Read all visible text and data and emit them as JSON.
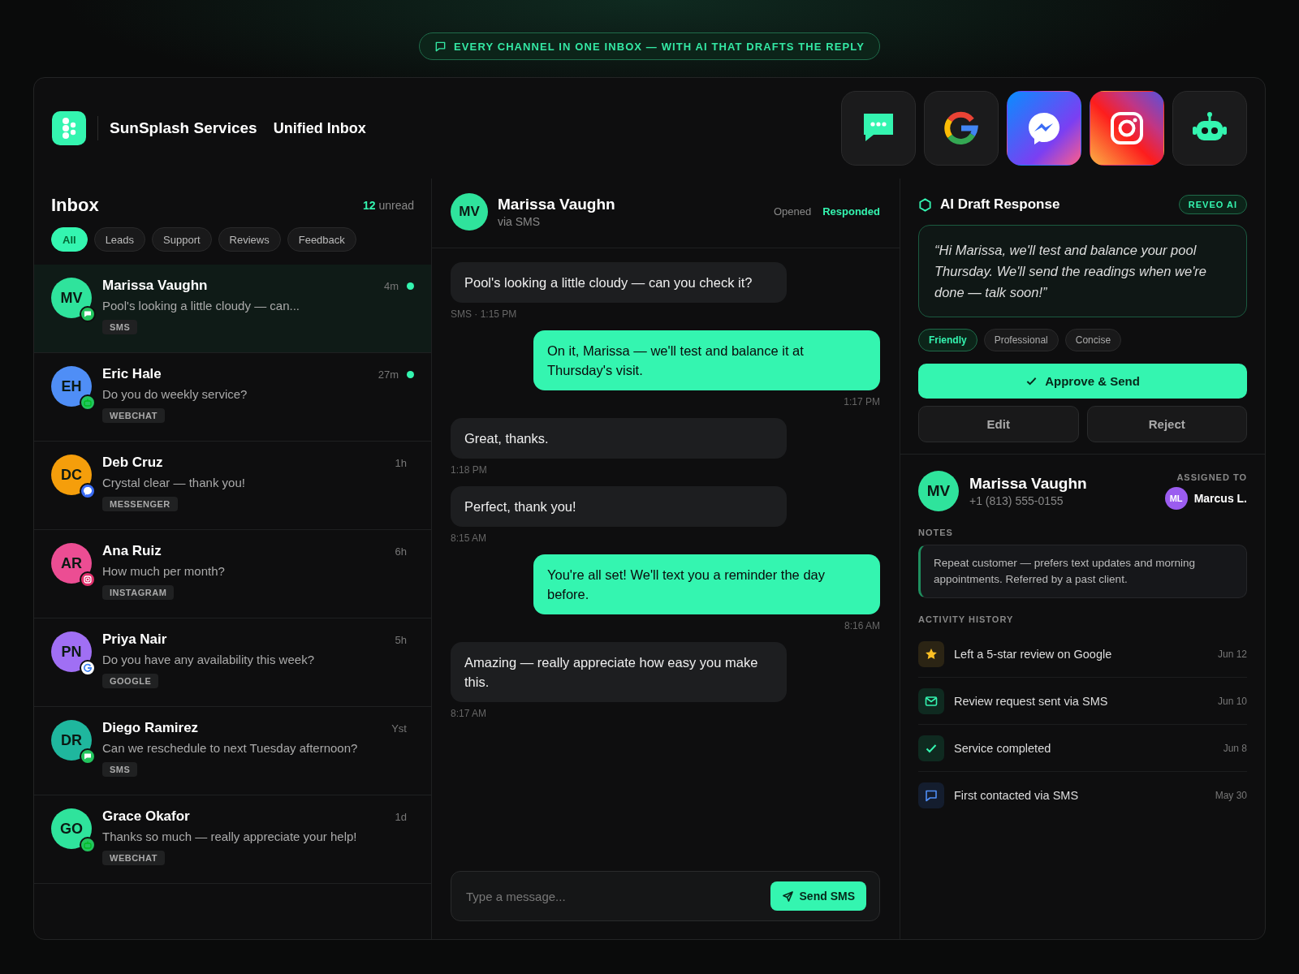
{
  "banner": {
    "text": "EVERY CHANNEL IN ONE INBOX — WITH AI THAT DRAFTS THE REPLY"
  },
  "header": {
    "brand": "SunSplash Services",
    "section": "Unified Inbox",
    "channels": [
      {
        "kind": "sms"
      },
      {
        "kind": "google"
      },
      {
        "kind": "messenger"
      },
      {
        "kind": "instagram"
      },
      {
        "kind": "bot"
      }
    ]
  },
  "inbox": {
    "title": "Inbox",
    "unread_count": "12",
    "unread_label": "unread",
    "filters": [
      {
        "label": "All",
        "selected": true
      },
      {
        "label": "Leads",
        "selected": false
      },
      {
        "label": "Support",
        "selected": false
      },
      {
        "label": "Reviews",
        "selected": false
      },
      {
        "label": "Feedback",
        "selected": false
      }
    ],
    "conversations": [
      {
        "initials": "MV",
        "name": "Marissa Vaughn",
        "preview": "Pool's looking a little cloudy — can...",
        "time": "4m",
        "kind": "sms",
        "tag": "SMS",
        "unread": true,
        "selected": true,
        "color": "#2fe39c"
      },
      {
        "initials": "EH",
        "name": "Eric Hale",
        "preview": "Do you do weekly service?",
        "time": "27m",
        "kind": "webchat",
        "tag": "WEBCHAT",
        "unread": true,
        "selected": false,
        "color": "#4f8ef6"
      },
      {
        "initials": "DC",
        "name": "Deb Cruz",
        "preview": "Crystal clear — thank you!",
        "time": "1h",
        "kind": "messenger",
        "tag": "MESSENGER",
        "unread": false,
        "selected": false,
        "color": "#f59e0b"
      },
      {
        "initials": "AR",
        "name": "Ana Ruiz",
        "preview": "How much per month?",
        "time": "6h",
        "kind": "instagram",
        "tag": "INSTAGRAM",
        "unread": false,
        "selected": false,
        "color": "#ec4d93"
      },
      {
        "initials": "PN",
        "name": "Priya Nair",
        "preview": "Do you have any availability this week?",
        "time": "5h",
        "kind": "google",
        "tag": "GOOGLE",
        "unread": false,
        "selected": false,
        "color": "#a06ff4"
      },
      {
        "initials": "DR",
        "name": "Diego Ramirez",
        "preview": "Can we reschedule to next Tuesday afternoon?",
        "time": "Yst",
        "kind": "sms",
        "tag": "SMS",
        "unread": false,
        "selected": false,
        "color": "#1fb79e"
      },
      {
        "initials": "GO",
        "name": "Grace Okafor",
        "preview": "Thanks so much — really appreciate your help!",
        "time": "1d",
        "kind": "webchat",
        "tag": "WEBCHAT",
        "unread": false,
        "selected": false,
        "color": "#2fe39c"
      }
    ]
  },
  "conversation": {
    "initials": "MV",
    "name": "Marissa Vaughn",
    "via": "via SMS",
    "statuses": [
      {
        "label": "Opened",
        "highlighted": false
      },
      {
        "label": "Responded",
        "highlighted": true
      }
    ],
    "messages": [
      {
        "kind": "in",
        "text": "Pool's looking a little cloudy — can you check it?",
        "meta": "SMS · 1:15 PM"
      },
      {
        "kind": "out",
        "text": "On it, Marissa — we'll test and balance it at Thursday's visit.",
        "meta": "1:17 PM"
      },
      {
        "kind": "in",
        "text": "Great, thanks.",
        "meta": "1:18 PM"
      },
      {
        "kind": "in",
        "text": "Perfect, thank you!",
        "meta": "8:15 AM"
      },
      {
        "kind": "out",
        "text": "You're all set! We'll text you a reminder the day before.",
        "meta": "8:16 AM"
      },
      {
        "kind": "in",
        "text": "Amazing — really appreciate how easy you make this.",
        "meta": "8:17 AM"
      }
    ],
    "composer": {
      "placeholder": "Type a message...",
      "send": "Send SMS"
    }
  },
  "ai_draft": {
    "title": "AI Draft Response",
    "badge": "REVEO AI",
    "draft": "“Hi Marissa, we'll test and balance your pool Thursday. We'll send the readings when we're done — talk soon!”",
    "tones": [
      {
        "label": "Friendly",
        "selected": true
      },
      {
        "label": "Professional",
        "selected": false
      },
      {
        "label": "Concise",
        "selected": false
      }
    ],
    "approve": "Approve & Send",
    "edit": "Edit",
    "reject": "Reject"
  },
  "contact": {
    "initials": "MV",
    "name": "Marissa Vaughn",
    "phone": "+1 (813) 555-0155",
    "assigned_label": "ASSIGNED TO",
    "assignee_initials": "ML",
    "assignee": "Marcus L.",
    "notes_label": "NOTES",
    "notes": "Repeat customer — prefers text updates and morning appointments. Referred by a past client.",
    "activity_label": "ACTIVITY HISTORY",
    "activity": [
      {
        "kind": "star",
        "text": "Left a 5-star review on Google",
        "date": "Jun 12"
      },
      {
        "kind": "mail",
        "text": "Review request sent via SMS",
        "date": "Jun 10"
      },
      {
        "kind": "check",
        "text": "Service completed",
        "date": "Jun 8"
      },
      {
        "kind": "chat",
        "text": "First contacted via SMS",
        "date": "May 30"
      }
    ]
  }
}
